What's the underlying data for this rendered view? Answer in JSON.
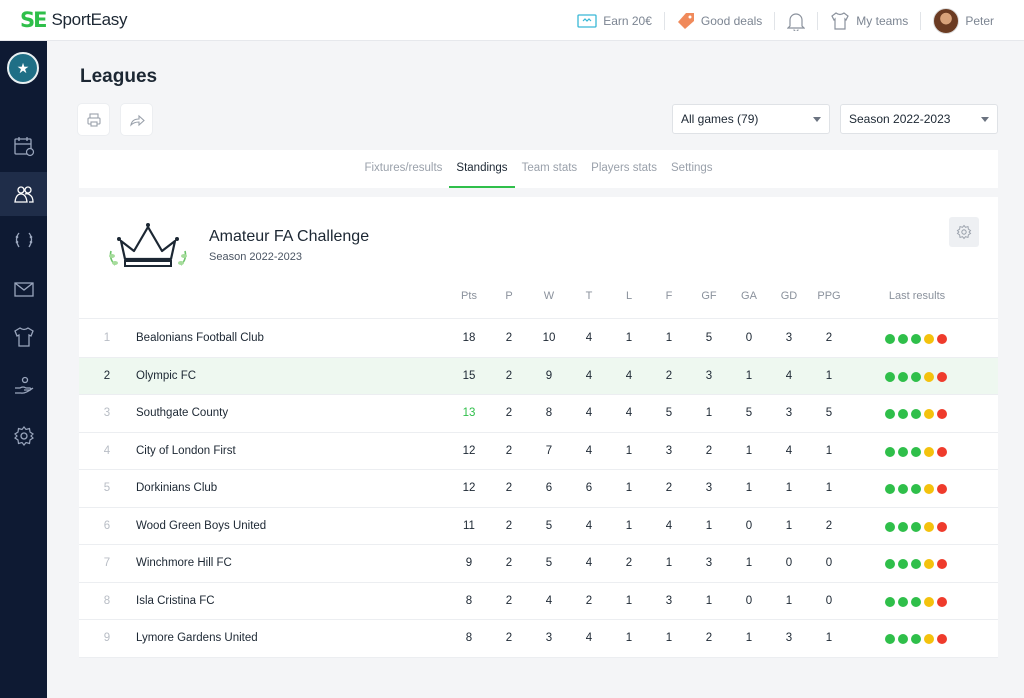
{
  "header": {
    "logo_mark": "SE",
    "brand": "SportEasy",
    "earn": "Earn 20€",
    "deals": "Good deals",
    "my_teams": "My teams",
    "user": "Peter"
  },
  "page": {
    "title": "Leagues",
    "filter_games": "All games (79)",
    "filter_season": "Season 2022-2023"
  },
  "tabs": [
    "Fixtures/results",
    "Standings",
    "Team stats",
    "Players stats",
    "Settings"
  ],
  "active_tab": 1,
  "league": {
    "name": "Amateur FA Challenge",
    "season": "Season 2022-2023"
  },
  "columns": [
    "Pts",
    "P",
    "W",
    "T",
    "L",
    "F",
    "GF",
    "GA",
    "GD",
    "PPG",
    "Last results"
  ],
  "colors": {
    "accent": "#2fbf4a",
    "win": "#2fbf4a",
    "draw": "#f4c20d",
    "loss": "#ef3b2c",
    "sidebar": "#0e1a33"
  },
  "rows": [
    {
      "rank": "1",
      "team": "Bealonians Football Club",
      "pts": "18",
      "p": "2",
      "w": "10",
      "t": "4",
      "l": "1",
      "f": "1",
      "gf": "5",
      "ga": "0",
      "gd": "3",
      "ppg": "2",
      "results": [
        "win",
        "win",
        "win",
        "draw",
        "loss"
      ]
    },
    {
      "rank": "2",
      "team": "Olympic FC",
      "pts": "15",
      "p": "2",
      "w": "9",
      "t": "4",
      "l": "4",
      "f": "2",
      "gf": "3",
      "ga": "1",
      "gd": "4",
      "ppg": "1",
      "results": [
        "win",
        "win",
        "win",
        "draw",
        "loss"
      ]
    },
    {
      "rank": "3",
      "team": "Southgate County",
      "pts": "13",
      "p": "2",
      "w": "8",
      "t": "4",
      "l": "4",
      "f": "5",
      "gf": "1",
      "ga": "5",
      "gd": "3",
      "ppg": "5",
      "results": [
        "win",
        "win",
        "win",
        "draw",
        "loss"
      ]
    },
    {
      "rank": "4",
      "team": "City of London First",
      "pts": "12",
      "p": "2",
      "w": "7",
      "t": "4",
      "l": "1",
      "f": "3",
      "gf": "2",
      "ga": "1",
      "gd": "4",
      "ppg": "1",
      "results": [
        "win",
        "win",
        "win",
        "draw",
        "loss"
      ]
    },
    {
      "rank": "5",
      "team": "Dorkinians Club",
      "pts": "12",
      "p": "2",
      "w": "6",
      "t": "6",
      "l": "1",
      "f": "2",
      "gf": "3",
      "ga": "1",
      "gd": "1",
      "ppg": "1",
      "results": [
        "win",
        "win",
        "win",
        "draw",
        "loss"
      ]
    },
    {
      "rank": "6",
      "team": "Wood Green Boys United",
      "pts": "11",
      "p": "2",
      "w": "5",
      "t": "4",
      "l": "1",
      "f": "4",
      "gf": "1",
      "ga": "0",
      "gd": "1",
      "ppg": "2",
      "results": [
        "win",
        "win",
        "win",
        "draw",
        "loss"
      ]
    },
    {
      "rank": "7",
      "team": "Winchmore Hill FC",
      "pts": "9",
      "p": "2",
      "w": "5",
      "t": "4",
      "l": "2",
      "f": "1",
      "gf": "3",
      "ga": "1",
      "gd": "0",
      "ppg": "0",
      "results": [
        "win",
        "win",
        "win",
        "draw",
        "loss"
      ]
    },
    {
      "rank": "8",
      "team": " Isla Cristina FC",
      "pts": "8",
      "p": "2",
      "w": "4",
      "t": "2",
      "l": "1",
      "f": "3",
      "gf": "1",
      "ga": "0",
      "gd": "1",
      "ppg": "0",
      "results": [
        "win",
        "win",
        "win",
        "draw",
        "loss"
      ]
    },
    {
      "rank": "9",
      "team": "Lymore Gardens United",
      "pts": "8",
      "p": "2",
      "w": "3",
      "t": "4",
      "l": "1",
      "f": "1",
      "gf": "2",
      "ga": "1",
      "gd": "3",
      "ppg": "1",
      "results": [
        "win",
        "win",
        "win",
        "draw",
        "loss"
      ]
    }
  ]
}
